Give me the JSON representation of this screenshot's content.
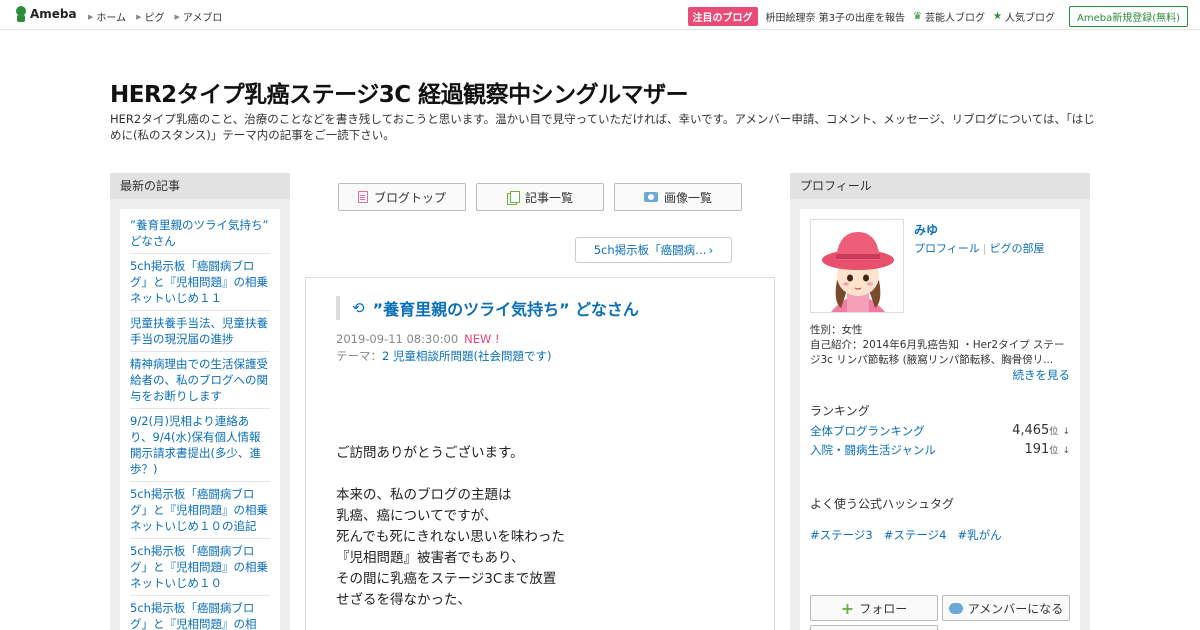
{
  "topbar": {
    "logo": "Ameba",
    "nav": [
      {
        "label": "ホーム"
      },
      {
        "label": "ピグ"
      },
      {
        "label": "アメブロ"
      }
    ],
    "featured_badge": "注目のブログ",
    "featured_link": "枡田絵理奈 第3子の出産を報告",
    "celeb_link": "芸能人ブログ",
    "popular_link": "人気ブログ",
    "register_button": "Ameba新規登録(無料)"
  },
  "blog": {
    "title": "HER2タイプ乳癌ステージ3C 経過観察中シングルマザー",
    "description": "HER2タイプ乳癌のこと、治療のことなどを書き残しておこうと思います。温かい目で見守っていただければ、幸いです。アメンバー申請、コメント、メッセージ、リブログについては、「はじめに(私のスタンス)」テーマ内の記事をご一読下さい。"
  },
  "left": {
    "heading": "最新の記事",
    "items": [
      "”養育里親のツライ気持ち” どなさん",
      "5ch掲示板「癌闘病ブログ」と『児相問題』の相乗ネットいじめ１１",
      "児童扶養手当法、児童扶養手当の現況届の進捗",
      "精神病理由での生活保護受給者の、私のブログへの関与をお断りします",
      "9/2(月)児相より連絡あり、9/4(水)保有個人情報開示請求書提出(多少、進歩？)",
      "5ch掲示板「癌闘病ブログ」と『児相問題』の相乗ネットいじめ１０の追記",
      "5ch掲示板「癌闘病ブログ」と『児相問題』の相乗ネットいじめ１０",
      "5ch掲示板「癌闘病ブログ」と『児相問題』の相"
    ]
  },
  "center": {
    "nav_buttons": [
      "ブログトップ",
      "記事一覧",
      "画像一覧"
    ],
    "next_link": "5ch掲示板「癌闘病…",
    "article": {
      "title": "”養育里親のツライ気持ち” どなさん",
      "date": "2019-09-11 08:30:00",
      "new_label": "NEW !",
      "theme_label": "テーマ：",
      "theme": "2 児童相談所問題(社会問題です)",
      "body": "ご訪問ありがとうございます。\n\n本来の、私のブログの主題は\n乳癌、癌についてですが、\n死んでも死にきれない思いを味わった\n『児相問題』被害者でもあり、\nその間に乳癌をステージ3Cまで放置\nせざるを得なかった、"
    }
  },
  "right": {
    "heading": "プロフィール",
    "name": "みゆ",
    "links": [
      "プロフィール",
      "ピグの部屋"
    ],
    "gender": "性別：女性",
    "intro": "自己紹介：2014年6月乳癌告知 ・Her2タイプ ステージ3c リンパ節転移 (腋窩リンパ節転移、胸骨傍リ...",
    "more": "続きを見る",
    "ranking_heading": "ランキング",
    "rankings": [
      {
        "label": "全体ブログランキング",
        "value": "4,465",
        "unit": "位",
        "arrow": "↓"
      },
      {
        "label": "入院・闘病生活ジャンル",
        "value": "191",
        "unit": "位",
        "arrow": "↓"
      }
    ],
    "hashtag_heading": "よく使う公式ハッシュタグ",
    "hashtags": [
      "#ステージ3",
      "#ステージ4",
      "#乳がん"
    ],
    "follow_button": "フォロー",
    "amember_button": "アメンバーになる"
  },
  "colors": {
    "brand_green": "#2d8c3c",
    "link_blue": "#0b6fb6",
    "hot_pink": "#e94b77"
  }
}
